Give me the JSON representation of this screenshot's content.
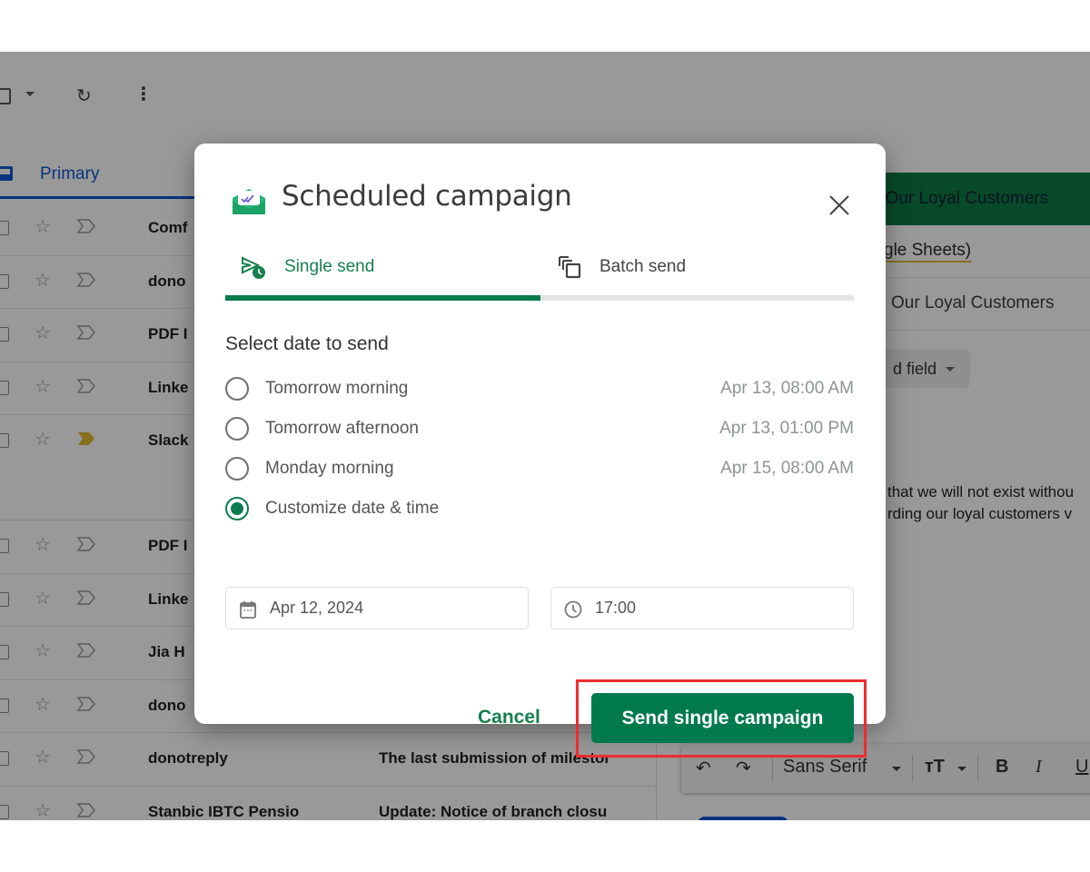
{
  "gmail": {
    "toolbar": {
      "select_icon": "checkbox-icon",
      "refresh_icon": "refresh-icon",
      "refresh_glyph": "↻",
      "more_icon": "more-vert-icon",
      "more_glyph": "⋮"
    },
    "tabs": [
      {
        "label": "Primary",
        "icon": "inbox-icon",
        "active": true
      }
    ],
    "mail_rows": [
      {
        "sender": "Comf",
        "subject": "",
        "important": false
      },
      {
        "sender": "dono",
        "subject": "",
        "important": false
      },
      {
        "sender": "PDF I",
        "subject": "",
        "important": false
      },
      {
        "sender": "Linke",
        "subject": "",
        "important": false
      },
      {
        "sender": "Slack",
        "subject": "",
        "important": true
      },
      {
        "sender": "PDF I",
        "subject": "",
        "important": false
      },
      {
        "sender": "Linke",
        "subject": "",
        "important": false
      },
      {
        "sender": "Jia H",
        "subject": "",
        "important": false
      },
      {
        "sender": "dono",
        "subject": "",
        "important": false
      },
      {
        "sender": "donotreply",
        "subject": "The last submission of milestor",
        "important": false
      },
      {
        "sender": "Stanbic IBTC Pensio",
        "subject": "Update: Notice of branch closu",
        "important": false
      }
    ],
    "star_glyph": "☆",
    "compose": {
      "header_title": "r Our Loyal Customers",
      "from_text": "gle Sheets)",
      "subject_text": "Our Loyal Customers",
      "merge_field_label": "d field",
      "body_lines": [
        "that we will not exist withou",
        "rding our loyal customers v"
      ],
      "format_bar": {
        "undo_glyph": "↶",
        "redo_glyph": "↷",
        "font_name": "Sans Serif",
        "size_glyph": "ᴛT",
        "bold": "B",
        "italic": "I",
        "underline": "U"
      }
    }
  },
  "dialog": {
    "title": "Scheduled campaign",
    "logo_icon": "mail-merge-logo-icon",
    "close_icon": "close-icon",
    "tabs": [
      {
        "label": "Single send",
        "icon": "scheduled-send-icon",
        "active": true
      },
      {
        "label": "Batch send",
        "icon": "copy-stack-icon",
        "active": false
      }
    ],
    "section_title": "Select date to send",
    "options": [
      {
        "label": "Tomorrow morning",
        "date": "Apr 13, 08:00 AM",
        "checked": false
      },
      {
        "label": "Tomorrow afternoon",
        "date": "Apr 13, 01:00 PM",
        "checked": false
      },
      {
        "label": "Monday morning",
        "date": "Apr 15, 08:00 AM",
        "checked": false
      },
      {
        "label": "Customize date & time",
        "date": "",
        "checked": true
      }
    ],
    "date_field": {
      "value": "Apr 12, 2024",
      "icon": "calendar-icon"
    },
    "time_field": {
      "value": "17:00",
      "icon": "clock-icon"
    },
    "cancel_label": "Cancel",
    "send_label": "Send single campaign",
    "colors": {
      "primary_green": "#007a4d",
      "highlight_red": "#ee2d2d",
      "gmail_blue": "#0b57d0",
      "important_yellow": "#e1b932"
    }
  }
}
